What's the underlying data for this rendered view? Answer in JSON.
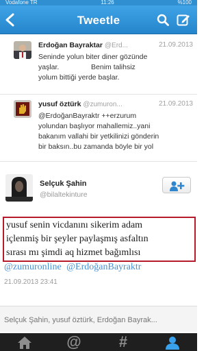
{
  "status_bar": {
    "carrier": "Vodafone TR",
    "time": "11:26",
    "battery": "%100"
  },
  "nav": {
    "back_icon": "chevron-left-icon",
    "title": "Tweetle",
    "search_icon": "search-icon",
    "compose_icon": "compose-icon"
  },
  "tweets": [
    {
      "name": "Erdoğan Bayraktar",
      "handle": "@Erd...",
      "date": "21.09.2013",
      "lines": [
        "Seninde yolun biter diner gözünde",
        "yaşlar.                Benim talihsiz",
        "yolum bittiği yerde başlar."
      ]
    },
    {
      "name": "yusuf öztürk",
      "handle": "@zumuron...",
      "date": "21.09.2013",
      "lines": [
        "@ErdoğanBayraktr ++erzurum",
        "yolundan başlıyor mahallemiz..yani",
        "bakanım vallahi bir yetkilinizi gönderin",
        "bir baksın..bu zamanda böyle bir yol"
      ]
    }
  ],
  "detail": {
    "name": "Selçuk Şahin",
    "handle": "@bilaltekinture",
    "follow_icon": "follow-user-icon",
    "lines": [
      "yusuf senin vicdanını sikerim adam",
      "içlenmiş bir şeyler paylaşmış asfaltın",
      "sırası mı şimdi aq hizmet bağımlısı"
    ],
    "mentions": [
      "@zumuronline",
      "@ErdoğanBayraktr"
    ],
    "timestamp": "21.09.2013 23:41"
  },
  "reply": {
    "placeholder": "Selçuk Şahin, yusuf öztürk, Erdoğan Bayrak..."
  },
  "tabs": [
    {
      "name": "home",
      "icon": "home-icon"
    },
    {
      "name": "mentions",
      "label": "@"
    },
    {
      "name": "discover",
      "label": "#"
    },
    {
      "name": "me",
      "icon": "user-icon"
    }
  ],
  "colors": {
    "nav": "#2585cc",
    "mention": "#4a8fd0",
    "highlight_border": "#b51a2a",
    "tabbar": "#1f1f1f"
  }
}
